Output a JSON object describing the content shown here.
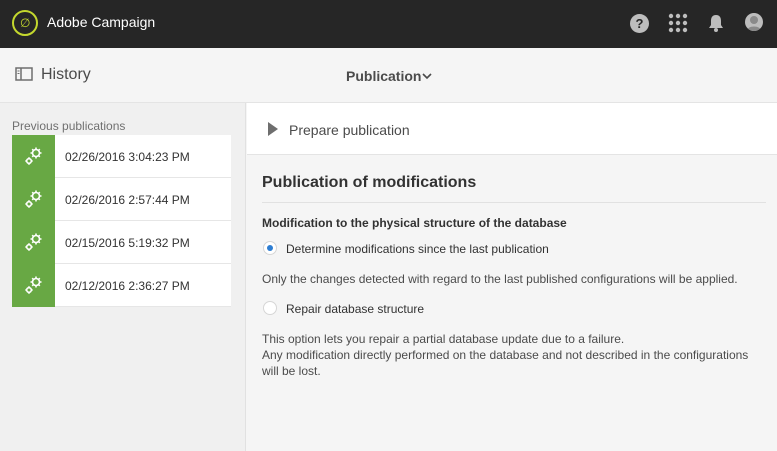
{
  "app": {
    "name": "Adobe Campaign"
  },
  "topbar": {
    "help_icon": "help-icon",
    "help_glyph": "?",
    "apps_icon": "apps-grid-icon",
    "notifications_icon": "bell-icon",
    "avatar_icon": "user-avatar-icon"
  },
  "header": {
    "title": "History",
    "title_icon": "history-panel-icon",
    "dropdown_label": "Publication",
    "dropdown_icon": "chevron-down-icon"
  },
  "left_panel": {
    "label": "Previous publications",
    "items": [
      {
        "date": "02/26/2016 3:04:23 PM",
        "icon": "gears-icon"
      },
      {
        "date": "02/26/2016 2:57:44 PM",
        "icon": "gears-icon"
      },
      {
        "date": "02/15/2016 5:19:32 PM",
        "icon": "gears-icon"
      },
      {
        "date": "02/12/2016 2:36:27 PM",
        "icon": "gears-icon"
      }
    ]
  },
  "main": {
    "prepare": {
      "label": "Prepare publication",
      "icon": "play-icon"
    },
    "section_title": "Publication of modifications",
    "subheading": "Modification to the physical structure of the database",
    "options": [
      {
        "label": "Determine modifications since the last publication",
        "selected": true,
        "description": "Only the changes detected with regard to the last published configurations will be applied."
      },
      {
        "label": "Repair database structure",
        "selected": false,
        "description_1": "This option lets you repair a partial database update due to a failure.",
        "description_2": "Any modification directly performed on the database and not described in the configurations will be lost."
      }
    ]
  },
  "colors": {
    "topbar_bg": "#262626",
    "logo_accent": "#c4d82e",
    "item_icon_bg": "#68a844",
    "radio_selected": "#2d7dd2"
  }
}
